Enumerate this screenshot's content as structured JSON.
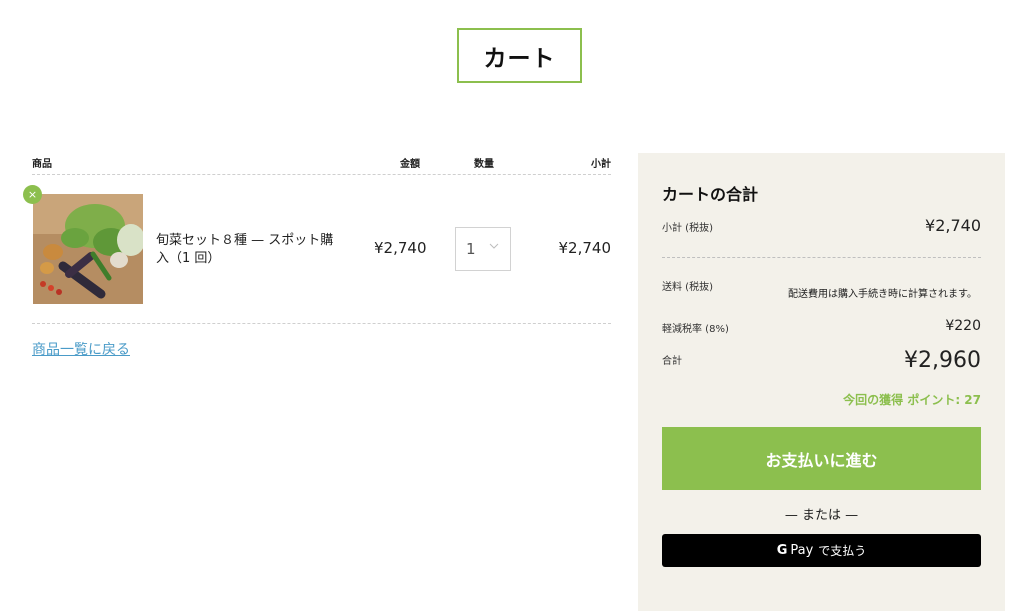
{
  "page": {
    "title": "カート"
  },
  "cart": {
    "headers": {
      "product": "商品",
      "price": "金額",
      "quantity": "数量",
      "subtotal": "小計"
    },
    "remove_icon": "×",
    "item": {
      "name": "旬菜セット８種 — スポット購入（1 回）",
      "price": "¥2,740",
      "quantity": "1",
      "subtotal": "¥2,740"
    },
    "back_link": "商品一覧に戻る"
  },
  "summary": {
    "title": "カートの合計",
    "subtotal_label": "小計 (税抜)",
    "subtotal_value": "¥2,740",
    "shipping_label": "送料 (税抜)",
    "shipping_note": "配送費用は購入手続き時に計算されます。",
    "tax_label": "軽減税率 (8%)",
    "tax_value": "¥220",
    "total_label": "合計",
    "total_value": "¥2,960",
    "points": "今回の獲得 ポイント: 27",
    "checkout_label": "お支払いに進む",
    "or_text": "— または —",
    "gpay": {
      "g": "G",
      "pay": "Pay",
      "label": "で支払う"
    }
  },
  "colors": {
    "accent": "#8cbf4e",
    "panel_bg": "#f3f1ea",
    "link": "#4a9bc8"
  },
  "icons": [
    "remove-icon",
    "chevron-down-icon",
    "google-g-icon"
  ]
}
